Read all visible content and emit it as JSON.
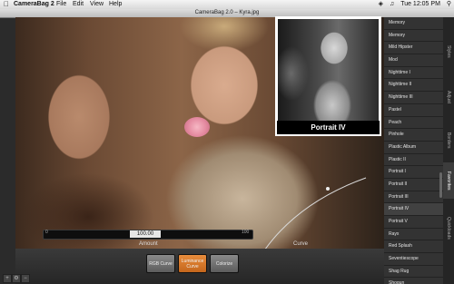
{
  "menubar": {
    "apple": "",
    "app_name": "CameraBag 2",
    "items": [
      "File",
      "Edit",
      "View",
      "Help"
    ],
    "status": "Tue 12:05 PM"
  },
  "window": {
    "title": "CameraBag 2.0 – Kyra.jpg"
  },
  "preview": {
    "label": "Portrait IV"
  },
  "slider": {
    "min": "0",
    "max": "100",
    "value": "100.00",
    "label": "Amount"
  },
  "curve": {
    "label": "Curve"
  },
  "buttons": {
    "rgb": "RGB Curve",
    "luminance": "Luminance Curve",
    "colorize": "Colorize"
  },
  "presets": [
    "Memory",
    "Memory",
    "Mild Hipster",
    "Mod",
    "Nighttime I",
    "Nighttime II",
    "Nighttime III",
    "Pastel",
    "Peach",
    "Pinhole",
    "Plastic Album",
    "Plastic II",
    "Portrait I",
    "Portrait II",
    "Portrait III",
    "Portrait IV",
    "Portrait V",
    "Rayx",
    "Red Splash",
    "Seventiescope",
    "Shag Rug",
    "Shogun"
  ],
  "selected_preset": "Portrait IV",
  "tabs": [
    "Styles",
    "Adjust",
    "Borders",
    "Favorites",
    "Quickloads"
  ],
  "active_tab": "Favorites",
  "colors": {
    "accent": "#e07a2c",
    "panel": "#2e2e2e"
  }
}
